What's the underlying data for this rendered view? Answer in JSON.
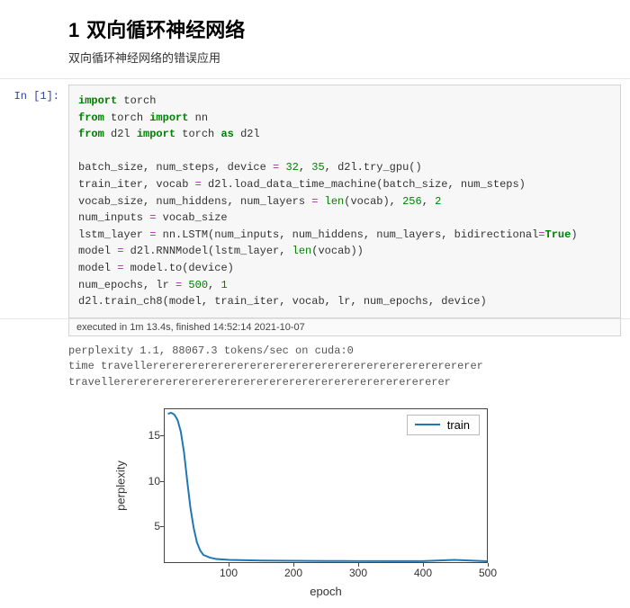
{
  "heading_num": "1",
  "heading_text": "双向循环神经网络",
  "subtitle": "双向循环神经网络的错误应用",
  "prompt_label": "In  [1]:",
  "code": {
    "l1a": "import",
    "l1b": " torch",
    "l2a": "from",
    "l2b": " torch ",
    "l2c": "import",
    "l2d": " nn",
    "l3a": "from",
    "l3b": " d2l ",
    "l3c": "import",
    "l3d": " torch ",
    "l3e": "as",
    "l3f": " d2l",
    "l5a": "batch_size, num_steps, device ",
    "l5op": "=",
    "l5n1": " 32",
    "l5c1": ", ",
    "l5n2": "35",
    "l5c2": ", d2l.try_gpu()",
    "l6a": "train_iter, vocab ",
    "l6op": "=",
    "l6b": " d2l.load_data_time_machine(batch_size, num_steps)",
    "l7a": "vocab_size, num_hiddens, num_layers ",
    "l7op": "=",
    "l7b": " ",
    "l7fn": "len",
    "l7c": "(vocab), ",
    "l7n1": "256",
    "l7c2": ", ",
    "l7n2": "2",
    "l8a": "num_inputs ",
    "l8op": "=",
    "l8b": " vocab_size",
    "l9a": "lstm_layer ",
    "l9op": "=",
    "l9b": " nn.LSTM(num_inputs, num_hiddens, num_layers, bidirectional",
    "l9eq": "=",
    "l9t": "True",
    "l9c": ")",
    "l10a": "model ",
    "l10op": "=",
    "l10b": " d2l.RNNModel(lstm_layer, ",
    "l10fn": "len",
    "l10c": "(vocab))",
    "l11a": "model ",
    "l11op": "=",
    "l11b": " model.to(device)",
    "l12a": "num_epochs, lr ",
    "l12op": "=",
    "l12n1": " 500",
    "l12c": ", ",
    "l12n2": "1",
    "l13a": "d2l.train_ch8(model, train_iter, vocab, lr, num_epochs, device)"
  },
  "exec_status": "executed in 1m 13.4s, finished 14:52:14 2021-10-07",
  "output_lines": [
    "perplexity 1.1, 88067.3 tokens/sec on cuda:0",
    "time travellerererererererererererererererererererererererererer",
    "travellerererererererererererererererererererererererererer"
  ],
  "chart_data": {
    "type": "line",
    "xlabel": "epoch",
    "ylabel": "perplexity",
    "xlim": [
      0,
      500
    ],
    "ylim": [
      1,
      18
    ],
    "xticks": [
      100,
      200,
      300,
      400,
      500
    ],
    "yticks": [
      5,
      10,
      15
    ],
    "legend_position": "upper-right",
    "series": [
      {
        "name": "train",
        "color": "#1f77b4",
        "x": [
          5,
          10,
          15,
          20,
          25,
          30,
          35,
          40,
          45,
          50,
          55,
          60,
          70,
          80,
          100,
          150,
          200,
          250,
          300,
          350,
          400,
          450,
          500
        ],
        "values": [
          17.5,
          17.6,
          17.4,
          16.8,
          15.5,
          13.2,
          10.0,
          7.0,
          4.8,
          3.2,
          2.3,
          1.8,
          1.5,
          1.35,
          1.25,
          1.18,
          1.15,
          1.13,
          1.12,
          1.11,
          1.11,
          1.25,
          1.1
        ]
      }
    ]
  }
}
